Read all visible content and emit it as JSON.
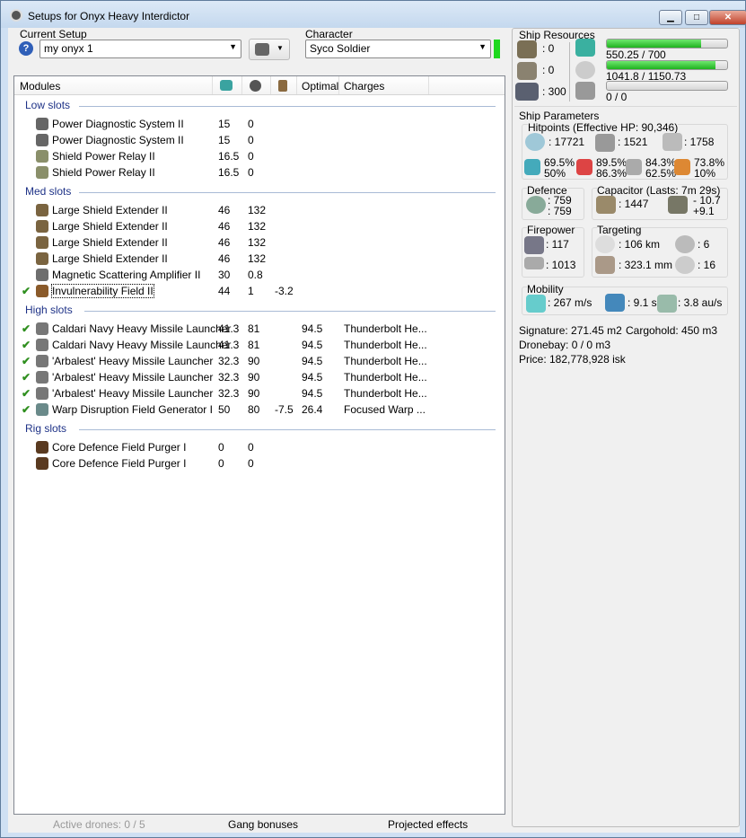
{
  "window": {
    "title": "Setups for Onyx Heavy Interdictor",
    "minimize": "▁",
    "maximize": "□",
    "close": "✕"
  },
  "setup": {
    "label": "Current Setup",
    "value": "my onyx 1",
    "help": "?"
  },
  "character": {
    "label": "Character",
    "value": "Syco Soldier",
    "status_color": "#1ed81e"
  },
  "columns": {
    "modules": "Modules",
    "optimal": "Optimal",
    "charges": "Charges"
  },
  "groups": [
    {
      "name": "Low slots",
      "rows": [
        {
          "name": "Power Diagnostic System II",
          "cpu": "15",
          "pg": "0",
          "cap": "",
          "optimal": "",
          "charges": "",
          "active": false,
          "color": "#666"
        },
        {
          "name": "Power Diagnostic System II",
          "cpu": "15",
          "pg": "0",
          "cap": "",
          "optimal": "",
          "charges": "",
          "active": false,
          "color": "#666"
        },
        {
          "name": "Shield Power Relay II",
          "cpu": "16.5",
          "pg": "0",
          "cap": "",
          "optimal": "",
          "charges": "",
          "active": false,
          "color": "#8a8f6a"
        },
        {
          "name": "Shield Power Relay II",
          "cpu": "16.5",
          "pg": "0",
          "cap": "",
          "optimal": "",
          "charges": "",
          "active": false,
          "color": "#8a8f6a"
        }
      ]
    },
    {
      "name": "Med slots",
      "rows": [
        {
          "name": "Large Shield Extender II",
          "cpu": "46",
          "pg": "132",
          "cap": "",
          "optimal": "",
          "charges": "",
          "active": false,
          "color": "#7a6440"
        },
        {
          "name": "Large Shield Extender II",
          "cpu": "46",
          "pg": "132",
          "cap": "",
          "optimal": "",
          "charges": "",
          "active": false,
          "color": "#7a6440"
        },
        {
          "name": "Large Shield Extender II",
          "cpu": "46",
          "pg": "132",
          "cap": "",
          "optimal": "",
          "charges": "",
          "active": false,
          "color": "#7a6440"
        },
        {
          "name": "Large Shield Extender II",
          "cpu": "46",
          "pg": "132",
          "cap": "",
          "optimal": "",
          "charges": "",
          "active": false,
          "color": "#7a6440"
        },
        {
          "name": "Magnetic Scattering Amplifier II",
          "cpu": "30",
          "pg": "0.8",
          "cap": "",
          "optimal": "",
          "charges": "",
          "active": false,
          "color": "#6e6e6e"
        },
        {
          "name": "Invulnerability Field II",
          "cpu": "44",
          "pg": "1",
          "cap": "-3.2",
          "optimal": "",
          "charges": "",
          "active": true,
          "color": "#8a5a2a",
          "focus": true
        }
      ]
    },
    {
      "name": "High slots",
      "rows": [
        {
          "name": "Caldari Navy Heavy Missile Launcher",
          "cpu": "41.3",
          "pg": "81",
          "cap": "",
          "optimal": "94.5",
          "charges": "Thunderbolt He...",
          "active": true,
          "color": "#777"
        },
        {
          "name": "Caldari Navy Heavy Missile Launcher",
          "cpu": "41.3",
          "pg": "81",
          "cap": "",
          "optimal": "94.5",
          "charges": "Thunderbolt He...",
          "active": true,
          "color": "#777"
        },
        {
          "name": "'Arbalest' Heavy Missile Launcher",
          "cpu": "32.3",
          "pg": "90",
          "cap": "",
          "optimal": "94.5",
          "charges": "Thunderbolt He...",
          "active": true,
          "color": "#777"
        },
        {
          "name": "'Arbalest' Heavy Missile Launcher",
          "cpu": "32.3",
          "pg": "90",
          "cap": "",
          "optimal": "94.5",
          "charges": "Thunderbolt He...",
          "active": true,
          "color": "#777"
        },
        {
          "name": "'Arbalest' Heavy Missile Launcher",
          "cpu": "32.3",
          "pg": "90",
          "cap": "",
          "optimal": "94.5",
          "charges": "Thunderbolt He...",
          "active": true,
          "color": "#777"
        },
        {
          "name": "Warp Disruption Field Generator I",
          "cpu": "50",
          "pg": "80",
          "cap": "-7.5",
          "optimal": "26.4",
          "charges": "Focused Warp ...",
          "active": true,
          "color": "#6a8a8a"
        }
      ]
    },
    {
      "name": "Rig slots",
      "rows": [
        {
          "name": "Core Defence Field Purger I",
          "cpu": "0",
          "pg": "0",
          "cap": "",
          "optimal": "",
          "charges": "",
          "active": false,
          "color": "#5a3a20"
        },
        {
          "name": "Core Defence Field Purger I",
          "cpu": "0",
          "pg": "0",
          "cap": "",
          "optimal": "",
          "charges": "",
          "active": false,
          "color": "#5a3a20"
        }
      ]
    }
  ],
  "footer": {
    "drones": "Active drones: 0 / 5",
    "gang": "Gang bonuses",
    "projected": "Projected effects"
  },
  "resources": {
    "title": "Ship Resources",
    "turrets": ": 0",
    "launchers": ": 0",
    "calibration": ": 300",
    "cpu": {
      "text": "550.25 / 700",
      "fraction": 0.786
    },
    "powergrid": {
      "text": "1041.8 / 1150.73",
      "fraction": 0.905
    },
    "drone_bw": {
      "text": "0 / 0",
      "fraction": 0
    }
  },
  "params": {
    "title": "Ship Parameters",
    "hitpoints_title": "Hitpoints (Effective HP: 90,346)",
    "shield": ": 17721",
    "armor": ": 1521",
    "structure": ": 1758",
    "res": [
      {
        "a": "69.5%",
        "b": "50%"
      },
      {
        "a": "89.5%",
        "b": "86.3%"
      },
      {
        "a": "84.3%",
        "b": "62.5%"
      },
      {
        "a": "73.8%",
        "b": "10%"
      }
    ],
    "defence_title": "Defence",
    "defence_a": ": 759",
    "defence_b": ": 759",
    "capacitor_title": "Capacitor (Lasts: 7m 29s)",
    "cap_amount": ": 1447",
    "cap_use": "- 10.7",
    "cap_regen": "+9.1",
    "firepower_title": "Firepower",
    "volley": ": 117",
    "dps": ": 1013",
    "targeting_title": "Targeting",
    "range": ": 106 km",
    "targets": ": 6",
    "scanres": ": 323.1 mm",
    "sensor": ": 16",
    "mobility_title": "Mobility",
    "speed": ": 267 m/s",
    "align": ": 9.1 s",
    "warp": ": 3.8 au/s",
    "signature": "Signature: 271.45 m2",
    "cargohold": "Cargohold: 450 m3",
    "dronebay": "Dronebay: 0 / 0 m3",
    "price": "Price: 182,778,928 isk"
  }
}
